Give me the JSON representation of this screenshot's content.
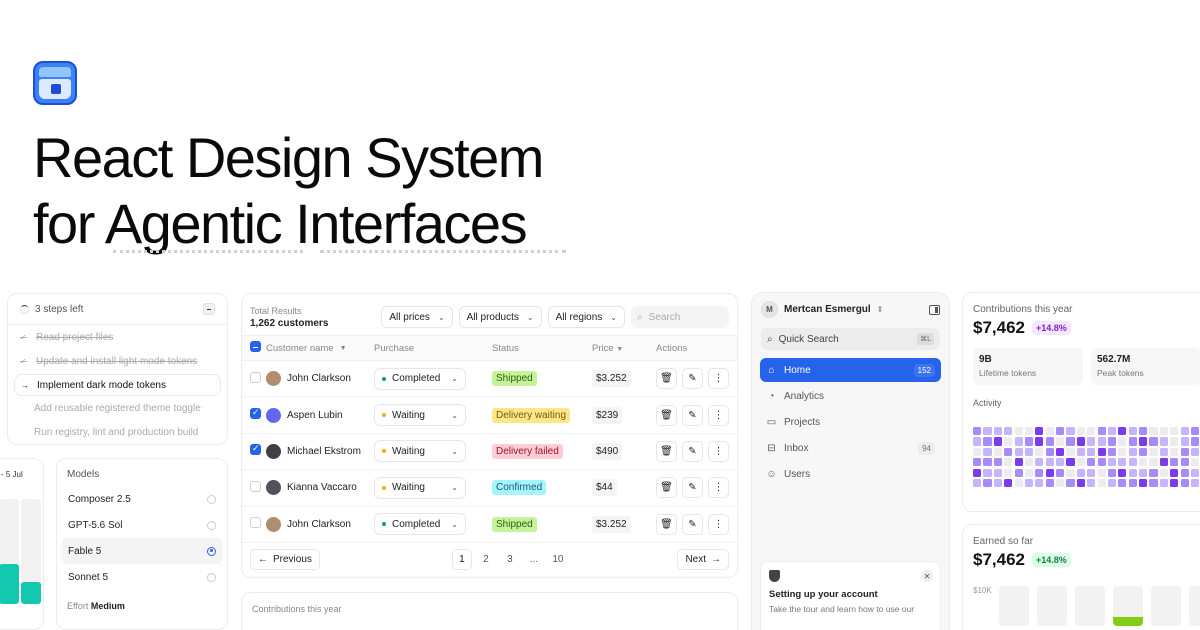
{
  "hero": {
    "title_line1": "React Design System",
    "title_line2": "for Agentic Interfaces"
  },
  "colors": {
    "brand": "#3b82f6",
    "accent": "#2563eb",
    "teal": "#12c9b0",
    "purple": "#7c3aed",
    "green_bar": "#84cc16"
  },
  "steps": {
    "header": "3 steps left",
    "items": [
      {
        "label": "Read project files",
        "state": "done"
      },
      {
        "label": "Update and install light mode tokens",
        "state": "done"
      },
      {
        "label": "Implement dark mode tokens",
        "state": "active"
      },
      {
        "label": "Add reusable registered theme toggle",
        "state": "todo"
      },
      {
        "label": "Run registry, lint and production build",
        "state": "todo"
      }
    ]
  },
  "sliver": {
    "tag": "- 5 Jul",
    "bars": [
      {
        "level": 0.38
      },
      {
        "level": 0.21
      }
    ]
  },
  "models": {
    "title": "Models",
    "items": [
      {
        "label": "Composer 2.5",
        "selected": false
      },
      {
        "label": "GPT-5.6 Sol",
        "selected": false
      },
      {
        "label": "Fable 5",
        "selected": true
      },
      {
        "label": "Sonnet 5",
        "selected": false
      }
    ],
    "effort_label": "Effort",
    "effort_value": "Medium"
  },
  "table": {
    "total_label": "Total Results",
    "total_value": "1,262 customers",
    "filters": [
      "All prices",
      "All products",
      "All regions"
    ],
    "search_placeholder": "Search",
    "columns": {
      "name": "Customer name",
      "purchase": "Purchase",
      "status": "Status",
      "price": "Price",
      "actions": "Actions"
    },
    "rows": [
      {
        "name": "John Clarkson",
        "checked": false,
        "purchase": "Completed",
        "purchase_dot": "#16a34a",
        "status": "Shipped",
        "status_bg": "#c6f29a",
        "status_fg": "#2f5d09",
        "price": "$3.252",
        "avatar": "#b08d6e"
      },
      {
        "name": "Aspen Lubin",
        "checked": true,
        "purchase": "Waiting",
        "purchase_dot": "#eab308",
        "status": "Delivery waiting",
        "status_bg": "#fde68a",
        "status_fg": "#7a5b05",
        "price": "$239",
        "avatar": "#6366f1"
      },
      {
        "name": "Michael Ekstrom",
        "checked": true,
        "purchase": "Waiting",
        "purchase_dot": "#eab308",
        "status": "Delivery failed",
        "status_bg": "#fecdd3",
        "status_fg": "#9f1239",
        "price": "$490",
        "avatar": "#3f3f46"
      },
      {
        "name": "Kianna Vaccaro",
        "checked": false,
        "purchase": "Waiting",
        "purchase_dot": "#eab308",
        "status": "Confirmed",
        "status_bg": "#a5f3fc",
        "status_fg": "#155e75",
        "price": "$44",
        "avatar": "#52525b"
      },
      {
        "name": "John Clarkson",
        "checked": false,
        "purchase": "Completed",
        "purchase_dot": "#16a34a",
        "status": "Shipped",
        "status_bg": "#c6f29a",
        "status_fg": "#2f5d09",
        "price": "$3.252",
        "avatar": "#b08d6e"
      }
    ],
    "pager": {
      "prev": "Previous",
      "next": "Next",
      "pages": [
        "1",
        "2",
        "3",
        "...",
        "10"
      ],
      "current": "1"
    }
  },
  "contrib_peek": {
    "label": "Contributions this year"
  },
  "sidebar": {
    "user_initial": "M",
    "user_name": "Mertcan Esmergul",
    "search_label": "Quick Search",
    "search_kbd": "⌘L",
    "items": [
      {
        "label": "Home",
        "icon": "home-icon",
        "count": "152",
        "active": true
      },
      {
        "label": "Analytics",
        "icon": "pie-chart-icon",
        "count": "",
        "active": false
      },
      {
        "label": "Projects",
        "icon": "folder-icon",
        "count": "",
        "active": false
      },
      {
        "label": "Inbox",
        "icon": "inbox-icon",
        "count": "94",
        "active": false
      },
      {
        "label": "Users",
        "icon": "smile-icon",
        "count": "",
        "active": false
      }
    ],
    "setup_title": "Setting up your account",
    "setup_desc": "Take the tour and learn how to use our"
  },
  "contributions": {
    "label": "Contributions this year",
    "value": "$7,462",
    "delta": "+14.8%",
    "kpis": [
      {
        "value": "9B",
        "label": "Lifetime tokens"
      },
      {
        "value": "562.7M",
        "label": "Peak tokens"
      }
    ],
    "activity_label": "Activity",
    "heat_rows": [
      "211100302100213120001211",
      "123012320231120232101231",
      "010211023011320120102120",
      "222030111302211100322023",
      "311020232011023112032111",
      "121301120231012232132120"
    ]
  },
  "earned": {
    "label": "Earned so far",
    "value": "$7,462",
    "delta": "+14.8%",
    "axis_tick": "$10K",
    "bars": [
      0,
      0,
      0,
      0.22,
      0,
      0
    ]
  }
}
